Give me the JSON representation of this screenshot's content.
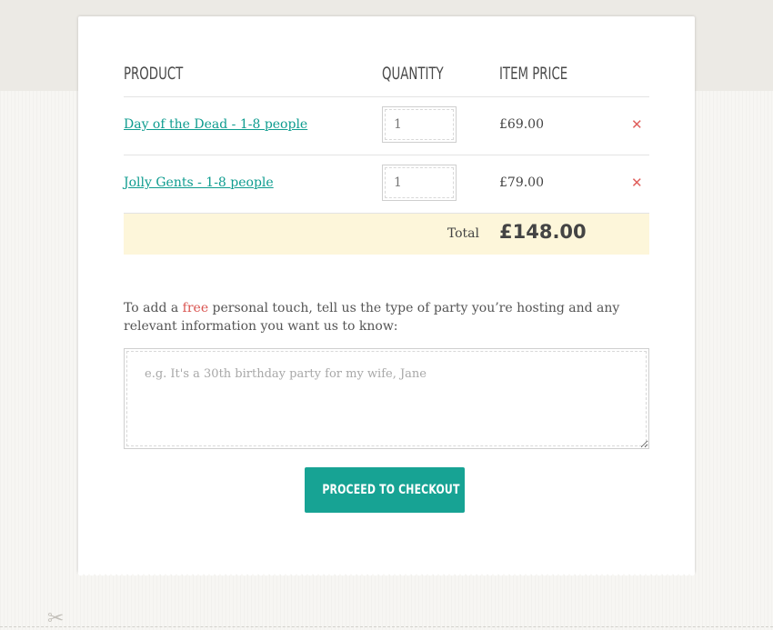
{
  "table": {
    "headers": {
      "product": "Product",
      "quantity": "Quantity",
      "price": "Item Price"
    },
    "rows": [
      {
        "product": "Day of the Dead - 1-8 people",
        "quantity": "1",
        "price": "£69.00",
        "remove_icon": "close-x-icon"
      },
      {
        "product": "Jolly Gents - 1-8 people",
        "quantity": "1",
        "price": "£79.00",
        "remove_icon": "close-x-icon"
      }
    ],
    "total_label": "Total",
    "total_value": "£148.00"
  },
  "note": {
    "text_before": "To add a ",
    "highlight": "free",
    "text_after": " personal touch, tell us the type of party you’re hosting and any relevant information you want us to know:",
    "placeholder": "e.g. It's a 30th birthday party for my wife, Jane",
    "value": ""
  },
  "checkout": {
    "label": "Proceed to checkout"
  },
  "icons": {
    "remove": "close-x-icon",
    "cut": "scissors-icon"
  },
  "colors": {
    "accent": "#17a394",
    "link": "#0e9c8f",
    "remove": "#e0605d",
    "highlight": "#d9534f",
    "total_background": "#fdf6da",
    "page_band": "#eceae5"
  }
}
